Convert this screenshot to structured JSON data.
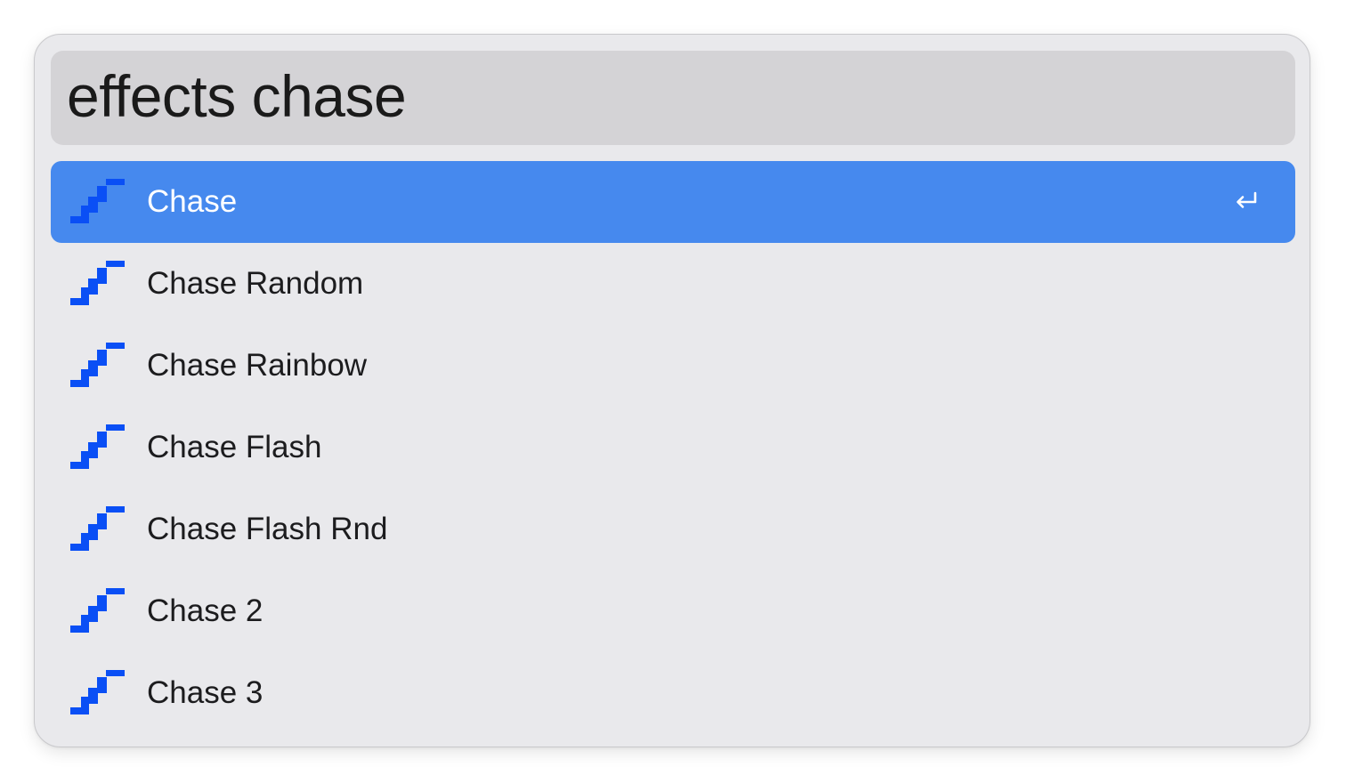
{
  "search": {
    "value": "effects chase",
    "placeholder": ""
  },
  "results": [
    {
      "label": "Chase",
      "icon": "chase-effect-icon",
      "selected": true
    },
    {
      "label": "Chase Random",
      "icon": "chase-effect-icon",
      "selected": false
    },
    {
      "label": "Chase Rainbow",
      "icon": "chase-effect-icon",
      "selected": false
    },
    {
      "label": "Chase Flash",
      "icon": "chase-effect-icon",
      "selected": false
    },
    {
      "label": "Chase Flash Rnd",
      "icon": "chase-effect-icon",
      "selected": false
    },
    {
      "label": "Chase 2",
      "icon": "chase-effect-icon",
      "selected": false
    },
    {
      "label": "Chase 3",
      "icon": "chase-effect-icon",
      "selected": false
    }
  ],
  "colors": {
    "accent": "#4689ee",
    "icon": "#0a4ff5",
    "background": "#e9e9ec",
    "search_field": "#d4d3d6"
  }
}
